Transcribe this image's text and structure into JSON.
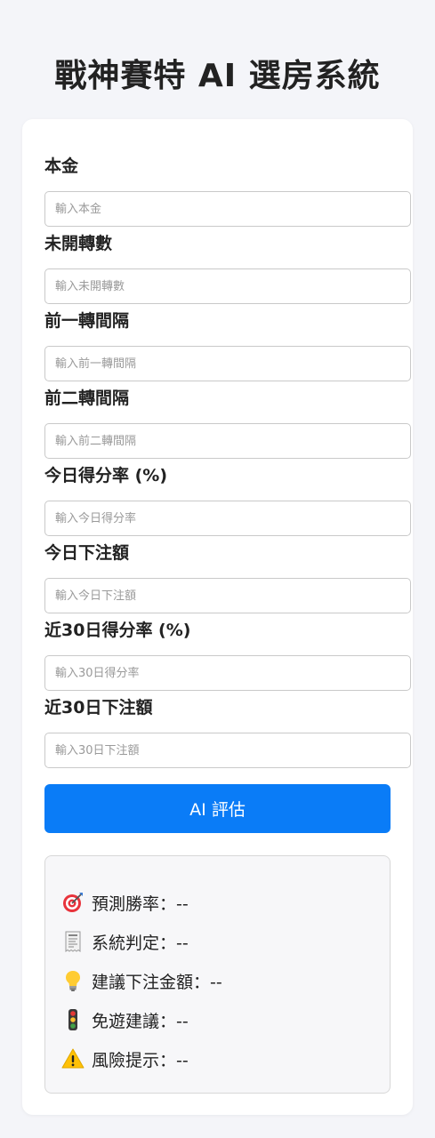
{
  "title": "戰神賽特 AI 選房系統",
  "fields": [
    {
      "label": "本金",
      "placeholder": "輸入本金",
      "value": ""
    },
    {
      "label": "未開轉數",
      "placeholder": "輸入未開轉數",
      "value": ""
    },
    {
      "label": "前一轉間隔",
      "placeholder": "輸入前一轉間隔",
      "value": ""
    },
    {
      "label": "前二轉間隔",
      "placeholder": "輸入前二轉間隔",
      "value": ""
    },
    {
      "label": "今日得分率 (%)",
      "placeholder": "輸入今日得分率",
      "value": ""
    },
    {
      "label": "今日下注額",
      "placeholder": "輸入今日下注額",
      "value": ""
    },
    {
      "label": "近30日得分率 (%)",
      "placeholder": "輸入30日得分率",
      "value": ""
    },
    {
      "label": "近30日下注額",
      "placeholder": "輸入30日下注額",
      "value": ""
    }
  ],
  "button": {
    "label": "AI 評估",
    "color": "#0a7cf7"
  },
  "results": [
    {
      "icon": "target-icon",
      "text": "預測勝率：--"
    },
    {
      "icon": "receipt-icon",
      "text": "系統判定：--"
    },
    {
      "icon": "lightbulb-icon",
      "text": "建議下注金額：--"
    },
    {
      "icon": "traffic-light-icon",
      "text": "免遊建議：--"
    },
    {
      "icon": "warning-icon",
      "text": "風險提示：--"
    }
  ]
}
